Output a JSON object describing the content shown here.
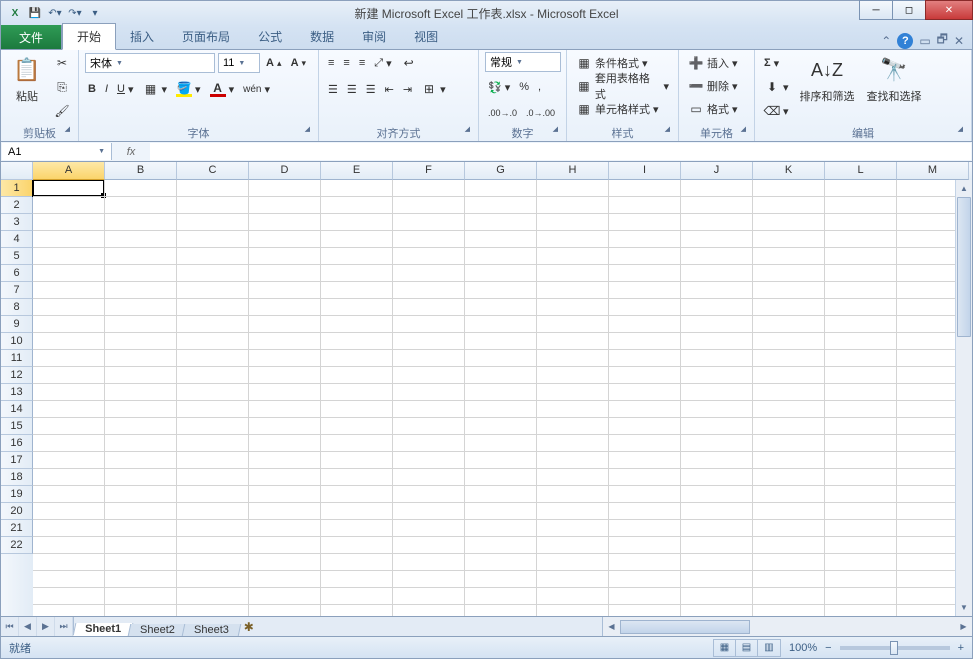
{
  "title": "新建 Microsoft Excel 工作表.xlsx  -  Microsoft Excel",
  "tabs": {
    "file": "文件",
    "home": "开始",
    "insert": "插入",
    "layout": "页面布局",
    "formulas": "公式",
    "data": "数据",
    "review": "审阅",
    "view": "视图"
  },
  "ribbon": {
    "clipboard": {
      "paste": "粘贴",
      "label": "剪贴板"
    },
    "font": {
      "name": "宋体",
      "size": "11",
      "label": "字体",
      "bold": "B",
      "italic": "I",
      "underline": "U"
    },
    "align": {
      "label": "对齐方式"
    },
    "number": {
      "format": "常规",
      "label": "数字"
    },
    "styles": {
      "cond": "条件格式",
      "table": "套用表格格式",
      "cell": "单元格样式",
      "label": "样式"
    },
    "cells": {
      "insert": "插入",
      "delete": "删除",
      "format": "格式",
      "label": "单元格"
    },
    "editing": {
      "sort": "排序和筛选",
      "find": "查找和选择",
      "label": "编辑"
    }
  },
  "namebox": "A1",
  "columns": [
    "A",
    "B",
    "C",
    "D",
    "E",
    "F",
    "G",
    "H",
    "I",
    "J",
    "K",
    "L",
    "M"
  ],
  "rows": [
    "1",
    "2",
    "3",
    "4",
    "5",
    "6",
    "7",
    "8",
    "9",
    "10",
    "11",
    "12",
    "13",
    "14",
    "15",
    "16",
    "17",
    "18",
    "19",
    "20",
    "21",
    "22"
  ],
  "active_cell": "A1",
  "sheets": [
    "Sheet1",
    "Sheet2",
    "Sheet3"
  ],
  "status": {
    "ready": "就绪",
    "zoom": "100%"
  }
}
